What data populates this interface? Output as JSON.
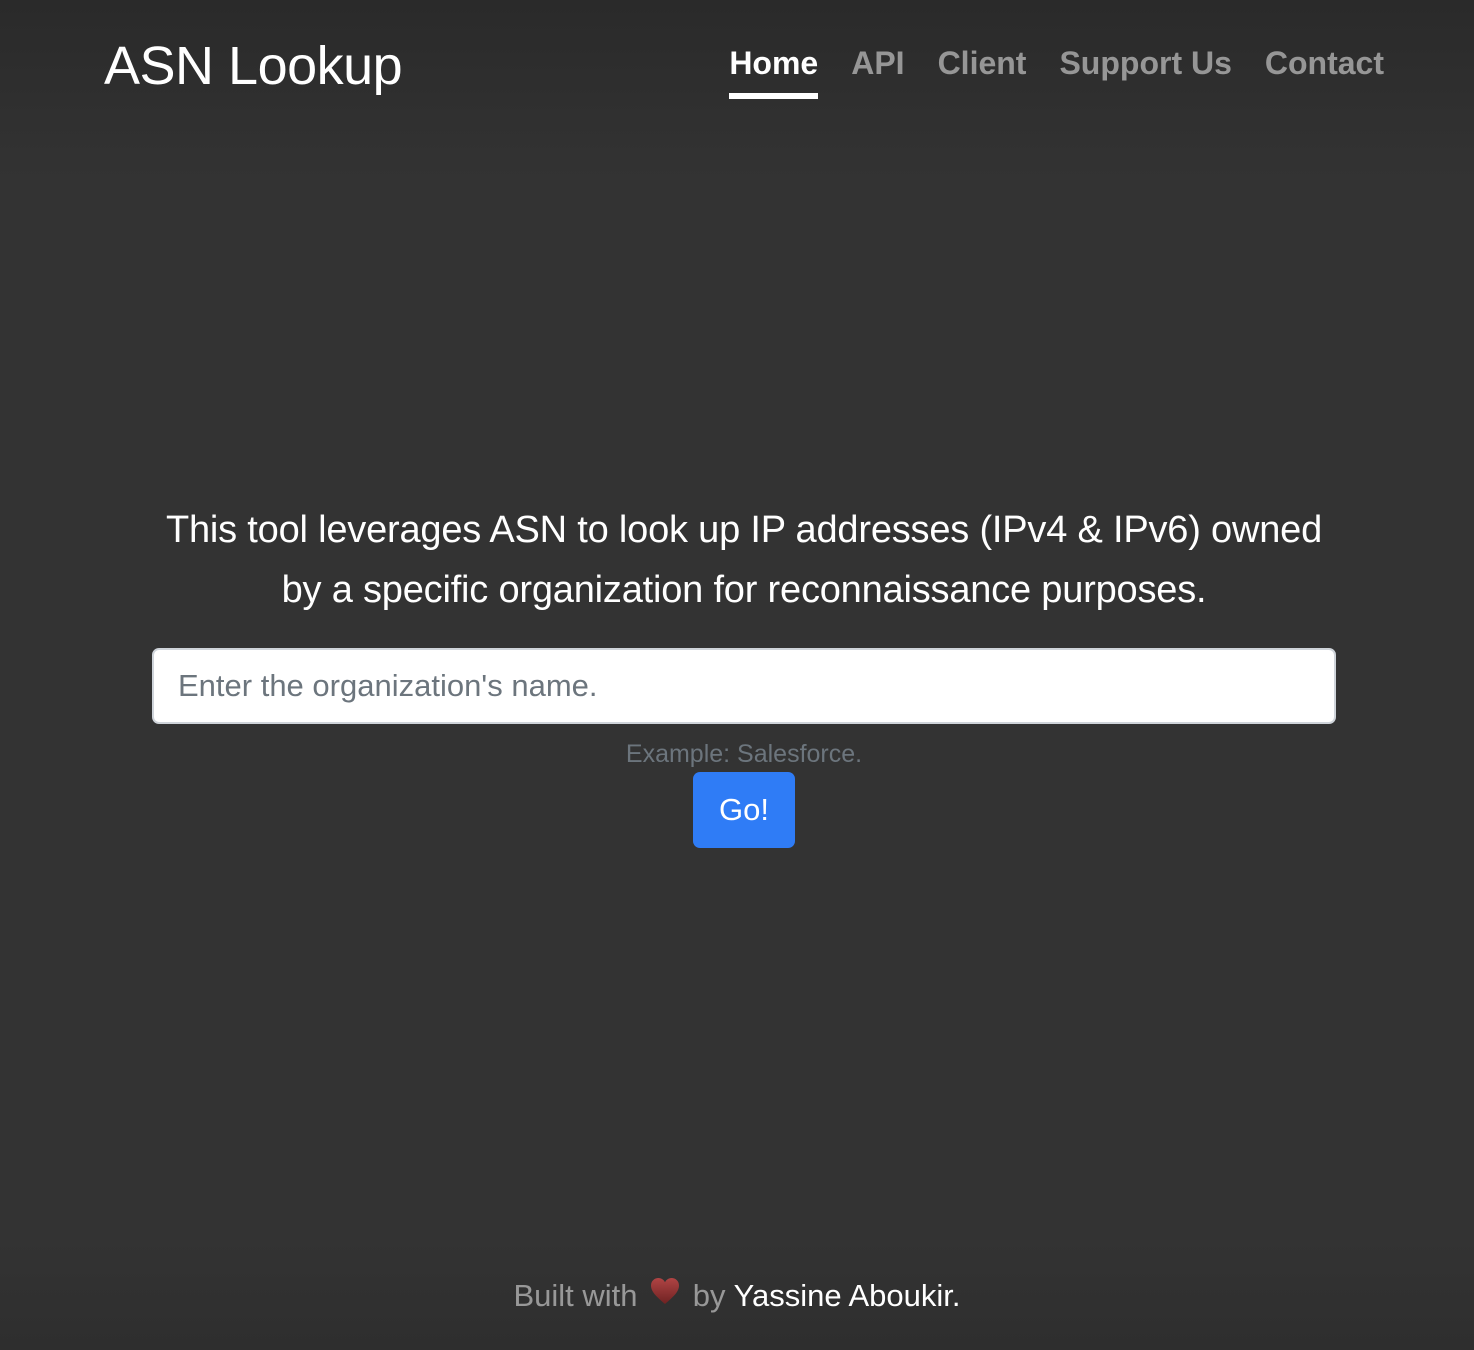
{
  "header": {
    "brand": "ASN Lookup",
    "nav": [
      {
        "label": "Home",
        "active": true
      },
      {
        "label": "API",
        "active": false
      },
      {
        "label": "Client",
        "active": false
      },
      {
        "label": "Support Us",
        "active": false
      },
      {
        "label": "Contact",
        "active": false
      }
    ]
  },
  "main": {
    "lead": "This tool leverages ASN to look up IP addresses (IPv4 & IPv6) owned by a specific organization for reconnaissance purposes.",
    "search": {
      "value": "",
      "placeholder": "Enter the organization's name."
    },
    "help_text": "Example: Salesforce.",
    "submit_label": "Go!"
  },
  "footer": {
    "prefix": "Built with",
    "icon": "heart-icon",
    "by": "by",
    "author": "Yassine Aboukir."
  },
  "colors": {
    "background": "#333333",
    "primary": "#2f7cf6",
    "muted": "#6c757d",
    "heart": "#8b2e2e"
  }
}
